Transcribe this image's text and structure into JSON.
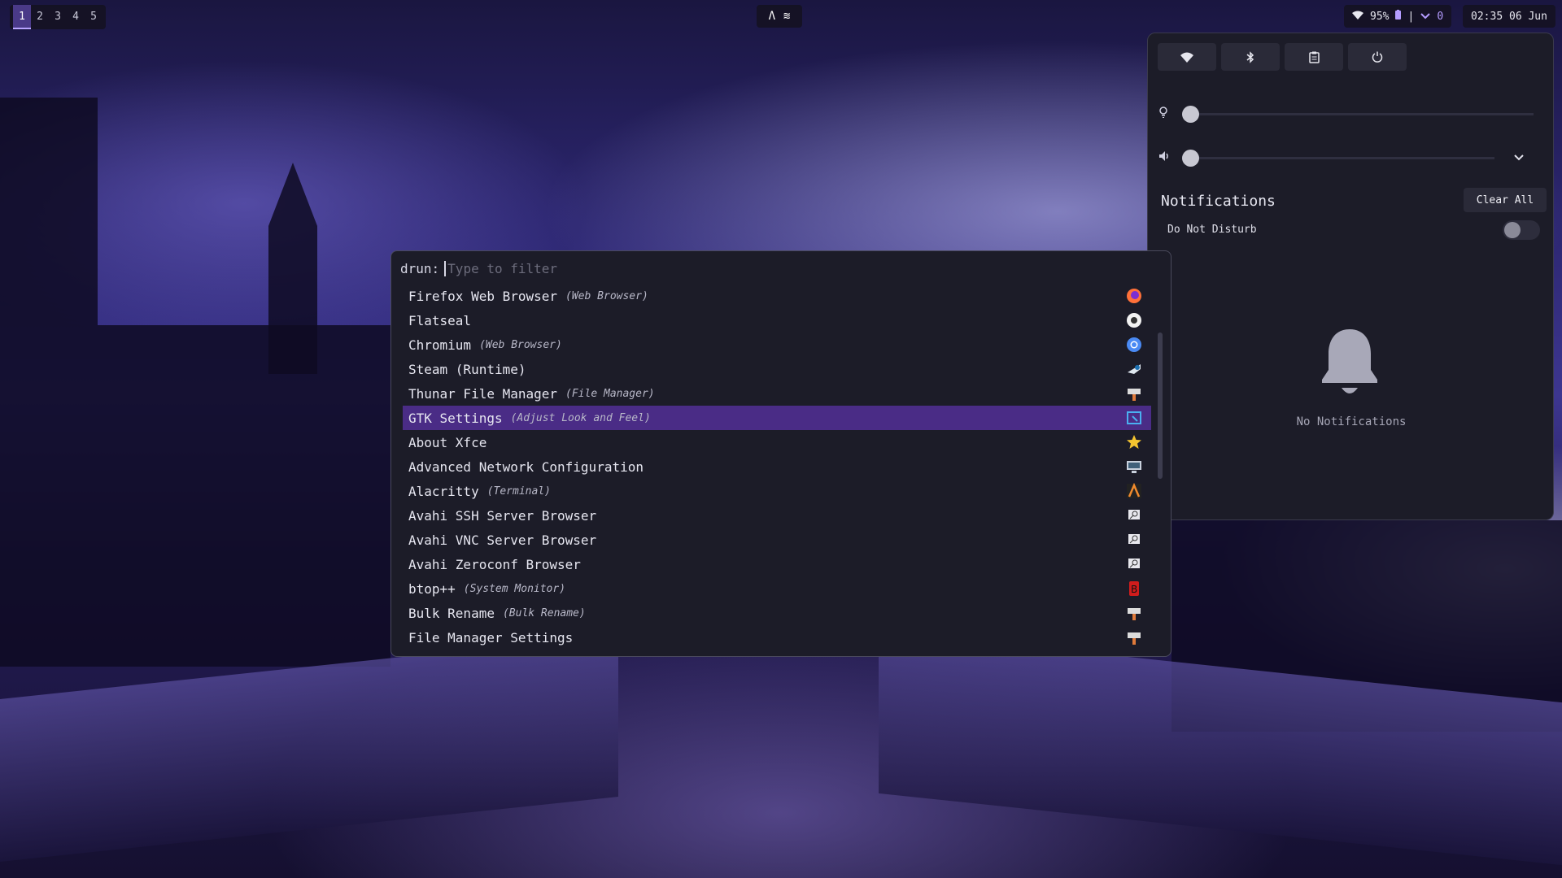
{
  "workspaces": [
    "1",
    "2",
    "3",
    "4",
    "5"
  ],
  "active_workspace": "1",
  "center_tray": {
    "icon1": "Λ",
    "icon2": "≋"
  },
  "status": {
    "wifi_icon": "wifi-icon",
    "battery_percent": "95%",
    "separator": "|",
    "notif_count": "0"
  },
  "clock": "02:35 06 Jun",
  "panel": {
    "quick_buttons": [
      "wifi-icon",
      "bluetooth-icon",
      "clipboard-icon",
      "power-icon"
    ],
    "brightness_level": 0,
    "volume_level": 0,
    "notifications_title": "Notifications",
    "clear_all_label": "Clear All",
    "dnd_label": "Do Not Disturb",
    "dnd_enabled": false,
    "empty_text": "No Notifications"
  },
  "launcher": {
    "prompt": "drun:",
    "placeholder": "Type to filter",
    "selected_index": 5,
    "items": [
      {
        "name": "Firefox Web Browser",
        "generic": "(Web Browser)",
        "icon": "firefox-icon"
      },
      {
        "name": "Flatseal",
        "generic": "",
        "icon": "flatseal-icon"
      },
      {
        "name": "Chromium",
        "generic": "(Web Browser)",
        "icon": "chromium-icon"
      },
      {
        "name": "Steam (Runtime)",
        "generic": "",
        "icon": "steam-icon"
      },
      {
        "name": "Thunar File Manager",
        "generic": "(File Manager)",
        "icon": "thunar-icon"
      },
      {
        "name": "GTK Settings",
        "generic": "(Adjust Look and Feel)",
        "icon": "gtk-settings-icon"
      },
      {
        "name": "About Xfce",
        "generic": "",
        "icon": "star-icon"
      },
      {
        "name": "Advanced Network Configuration",
        "generic": "",
        "icon": "network-icon"
      },
      {
        "name": "Alacritty",
        "generic": "(Terminal)",
        "icon": "alacritty-icon"
      },
      {
        "name": "Avahi SSH Server Browser",
        "generic": "",
        "icon": "avahi-icon"
      },
      {
        "name": "Avahi VNC Server Browser",
        "generic": "",
        "icon": "avahi-icon"
      },
      {
        "name": "Avahi Zeroconf Browser",
        "generic": "",
        "icon": "avahi-icon"
      },
      {
        "name": "btop++",
        "generic": "(System Monitor)",
        "icon": "btop-icon"
      },
      {
        "name": "Bulk Rename",
        "generic": "(Bulk Rename)",
        "icon": "bulk-rename-icon"
      },
      {
        "name": "File Manager Settings",
        "generic": "",
        "icon": "file-manager-settings-icon"
      }
    ]
  },
  "colors": {
    "accent": "#4a2c86",
    "panel_bg": "#1c1c28"
  }
}
